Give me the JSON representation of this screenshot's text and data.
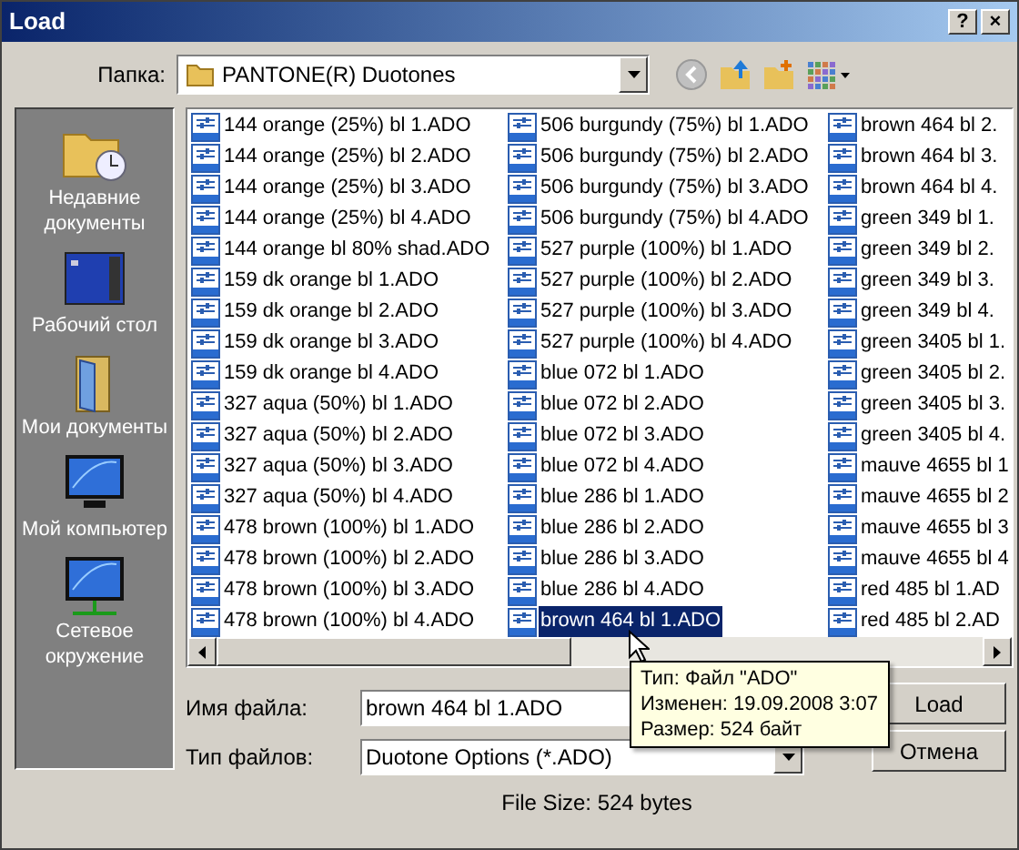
{
  "window": {
    "title": "Load",
    "buttons": [
      "?",
      "×"
    ]
  },
  "folder": {
    "label": "Папка:",
    "value": "PANTONE(R) Duotones"
  },
  "places": [
    {
      "label": "Недавние документы"
    },
    {
      "label": "Рабочий стол"
    },
    {
      "label": "Мои документы"
    },
    {
      "label": "Мой компьютер"
    },
    {
      "label": "Сетевое окружение"
    }
  ],
  "file_columns": [
    [
      {
        "name": "144 orange (25%) bl 1.ADO",
        "selected": false
      },
      {
        "name": "144 orange (25%) bl 2.ADO",
        "selected": false
      },
      {
        "name": "144 orange (25%) bl 3.ADO",
        "selected": false
      },
      {
        "name": "144 orange (25%) bl 4.ADO",
        "selected": false
      },
      {
        "name": "144 orange bl 80% shad.ADO",
        "selected": false
      },
      {
        "name": "159 dk orange bl 1.ADO",
        "selected": false
      },
      {
        "name": "159 dk orange bl 2.ADO",
        "selected": false
      },
      {
        "name": "159 dk orange bl 3.ADO",
        "selected": false
      },
      {
        "name": "159 dk orange bl 4.ADO",
        "selected": false
      },
      {
        "name": "327 aqua (50%) bl 1.ADO",
        "selected": false
      },
      {
        "name": "327 aqua (50%) bl 2.ADO",
        "selected": false
      },
      {
        "name": "327 aqua (50%) bl 3.ADO",
        "selected": false
      },
      {
        "name": "327 aqua (50%) bl 4.ADO",
        "selected": false
      },
      {
        "name": "478 brown (100%) bl 1.ADO",
        "selected": false
      },
      {
        "name": "478 brown (100%) bl 2.ADO",
        "selected": false
      },
      {
        "name": "478 brown (100%) bl 3.ADO",
        "selected": false
      },
      {
        "name": "478 brown (100%) bl 4.ADO",
        "selected": false
      }
    ],
    [
      {
        "name": "506 burgundy (75%) bl 1.ADO",
        "selected": false
      },
      {
        "name": "506 burgundy (75%) bl 2.ADO",
        "selected": false
      },
      {
        "name": "506 burgundy (75%) bl 3.ADO",
        "selected": false
      },
      {
        "name": "506 burgundy (75%) bl 4.ADO",
        "selected": false
      },
      {
        "name": "527 purple (100%) bl 1.ADO",
        "selected": false
      },
      {
        "name": "527 purple (100%) bl 2.ADO",
        "selected": false
      },
      {
        "name": "527 purple (100%) bl 3.ADO",
        "selected": false
      },
      {
        "name": "527 purple (100%) bl 4.ADO",
        "selected": false
      },
      {
        "name": "blue 072 bl 1.ADO",
        "selected": false
      },
      {
        "name": "blue 072 bl 2.ADO",
        "selected": false
      },
      {
        "name": "blue 072 bl 3.ADO",
        "selected": false
      },
      {
        "name": "blue 072 bl 4.ADO",
        "selected": false
      },
      {
        "name": "blue 286 bl 1.ADO",
        "selected": false
      },
      {
        "name": "blue 286 bl 2.ADO",
        "selected": false
      },
      {
        "name": "blue 286 bl 3.ADO",
        "selected": false
      },
      {
        "name": "blue 286 bl 4.ADO",
        "selected": false
      },
      {
        "name": "brown 464 bl 1.ADO",
        "selected": true
      }
    ],
    [
      {
        "name": "brown 464 bl 2.",
        "selected": false
      },
      {
        "name": "brown 464 bl 3.",
        "selected": false
      },
      {
        "name": "brown 464 bl 4.",
        "selected": false
      },
      {
        "name": "green 349 bl 1.",
        "selected": false
      },
      {
        "name": "green 349 bl 2.",
        "selected": false
      },
      {
        "name": "green 349 bl 3.",
        "selected": false
      },
      {
        "name": "green 349 bl 4.",
        "selected": false
      },
      {
        "name": "green 3405 bl 1.",
        "selected": false
      },
      {
        "name": "green 3405 bl 2.",
        "selected": false
      },
      {
        "name": "green 3405 bl 3.",
        "selected": false
      },
      {
        "name": "green 3405 bl 4.",
        "selected": false
      },
      {
        "name": "mauve 4655 bl 1",
        "selected": false
      },
      {
        "name": "mauve 4655 bl 2",
        "selected": false
      },
      {
        "name": "mauve 4655 bl 3",
        "selected": false
      },
      {
        "name": "mauve 4655 bl 4",
        "selected": false
      },
      {
        "name": "red 485 bl 1.AD",
        "selected": false
      },
      {
        "name": "red 485 bl 2.AD",
        "selected": false
      }
    ]
  ],
  "file_name": {
    "label": "Имя файла:",
    "value": "brown 464 bl 1.ADO"
  },
  "file_type": {
    "label": "Тип файлов:",
    "value": "Duotone Options (*.ADO)"
  },
  "tooltip": [
    "Тип: Файл \"ADO\"",
    "Изменен: 19.09.2008 3:07",
    "Размер: 524 байт"
  ],
  "buttons": [
    "Load",
    "Отмена"
  ],
  "status": "File Size: 524 bytes"
}
